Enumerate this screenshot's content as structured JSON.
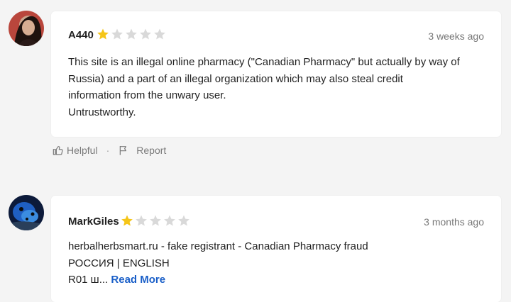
{
  "reviews": [
    {
      "author": "A440",
      "rating": 1,
      "max_rating": 5,
      "time": "3 weeks ago",
      "lines": [
        "This site is an illegal online pharmacy (\"Canadian Pharmacy\" but actually by way of",
        "Russia) and a part of an illegal organization which may also steal credit",
        "information from the unwary user.",
        "Untrustworthy."
      ],
      "helpful_label": "Helpful",
      "separator": "·",
      "report_label": "Report"
    },
    {
      "author": "MarkGiles",
      "rating": 1,
      "max_rating": 5,
      "time": "3 months ago",
      "lines": [
        "herbalherbsmart.ru - fake registrant - Canadian Pharmacy fraud",
        "РОССИЯ | ENGLISH",
        "R01 ш..."
      ],
      "read_more": "Read More"
    }
  ],
  "colors": {
    "star_filled": "#f5c518",
    "star_empty": "#d9d9d9",
    "link": "#1a5fc8",
    "muted": "#777777"
  },
  "icons": [
    "thumbs-up-icon",
    "flag-icon",
    "star-icon"
  ]
}
